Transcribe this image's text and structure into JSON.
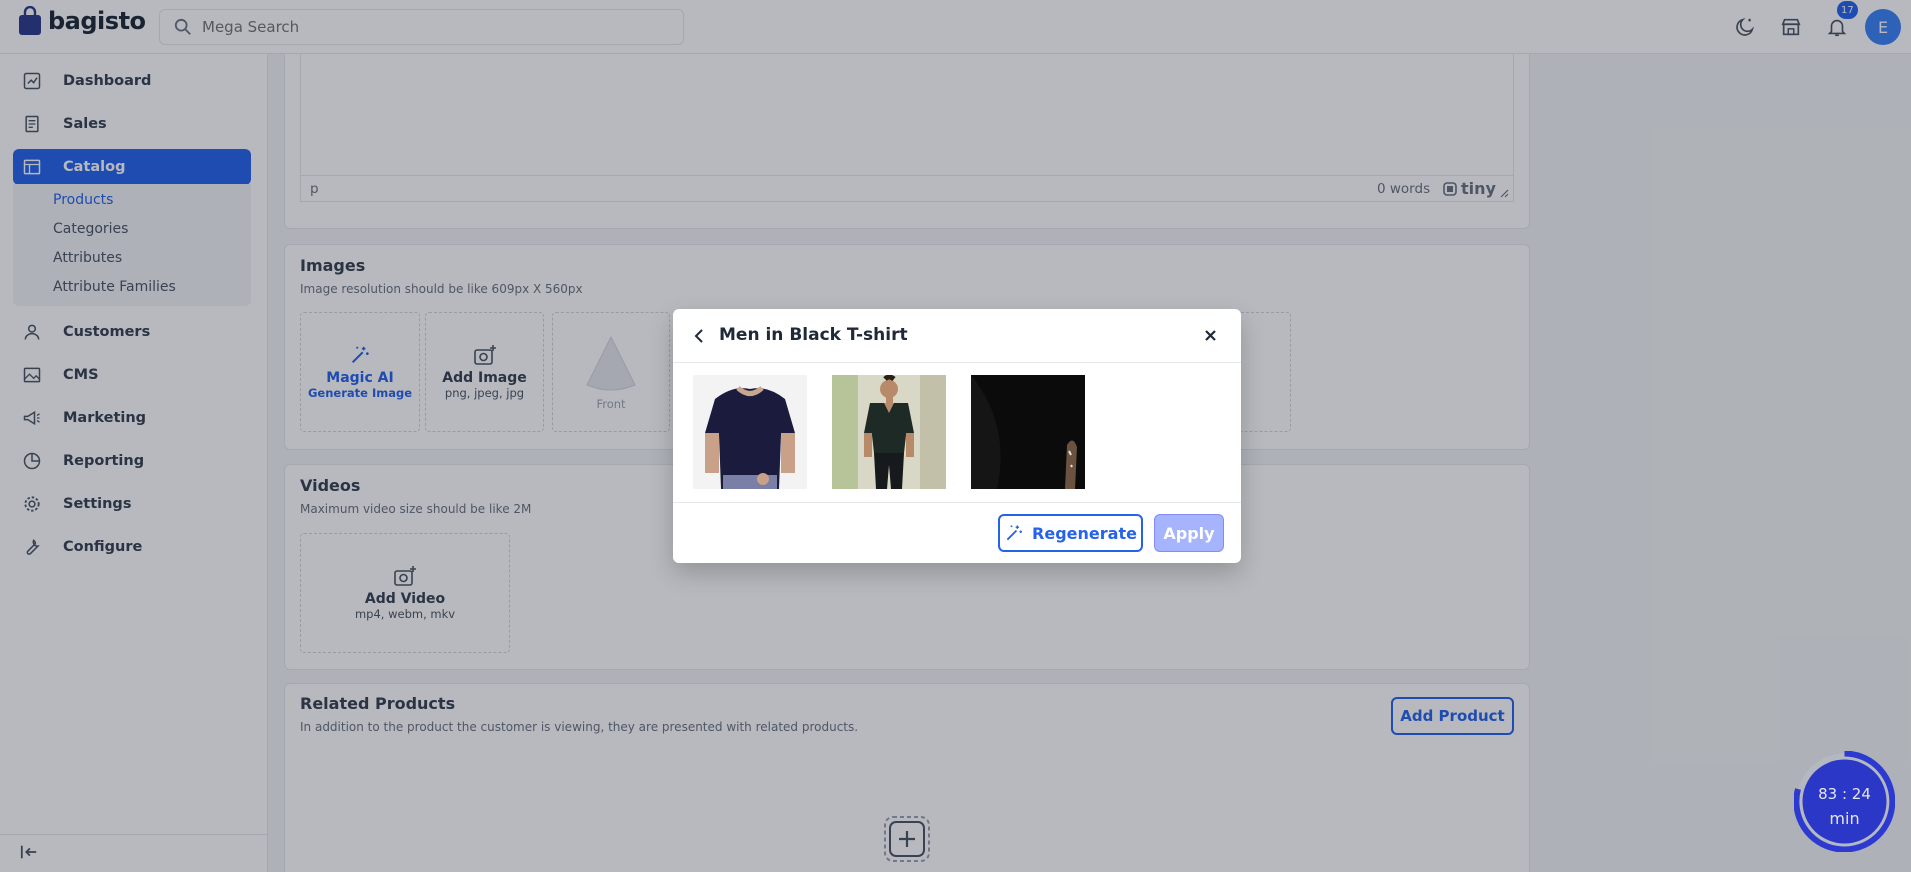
{
  "app": {
    "brand": "bagisto"
  },
  "search": {
    "placeholder": "Mega Search"
  },
  "header": {
    "notification_count": "17",
    "avatar_initial": "E"
  },
  "sidebar": {
    "items": [
      {
        "label": "Dashboard"
      },
      {
        "label": "Sales"
      },
      {
        "label": "Catalog"
      },
      {
        "label": "Customers"
      },
      {
        "label": "CMS"
      },
      {
        "label": "Marketing"
      },
      {
        "label": "Reporting"
      },
      {
        "label": "Settings"
      },
      {
        "label": "Configure"
      }
    ],
    "catalog_sub": [
      "Products",
      "Categories",
      "Attributes",
      "Attribute Families"
    ]
  },
  "editor": {
    "tag": "p",
    "word_count": "0 words",
    "brand": "tiny"
  },
  "images": {
    "title": "Images",
    "subtitle": "Image resolution should be like 609px X 560px",
    "magic_title": "Magic AI",
    "magic_sub": "Generate Image",
    "add_title": "Add Image",
    "add_sub": "png, jpeg, jpg",
    "front_label": "Front"
  },
  "videos": {
    "title": "Videos",
    "subtitle": "Maximum video size should be like 2M",
    "add_title": "Add Video",
    "add_sub": "mp4, webm, mkv"
  },
  "related": {
    "title": "Related Products",
    "subtitle": "In addition to the product the customer is viewing, they are presented with related products.",
    "add_button": "Add Product"
  },
  "modal": {
    "title": "Men in Black T-shirt",
    "regenerate_label": "Regenerate",
    "apply_label": "Apply"
  },
  "timer": {
    "value": "83 : 24",
    "unit": "min"
  },
  "colors": {
    "primary": "#2563eb",
    "apply_disabled": "#a5b4fc"
  }
}
